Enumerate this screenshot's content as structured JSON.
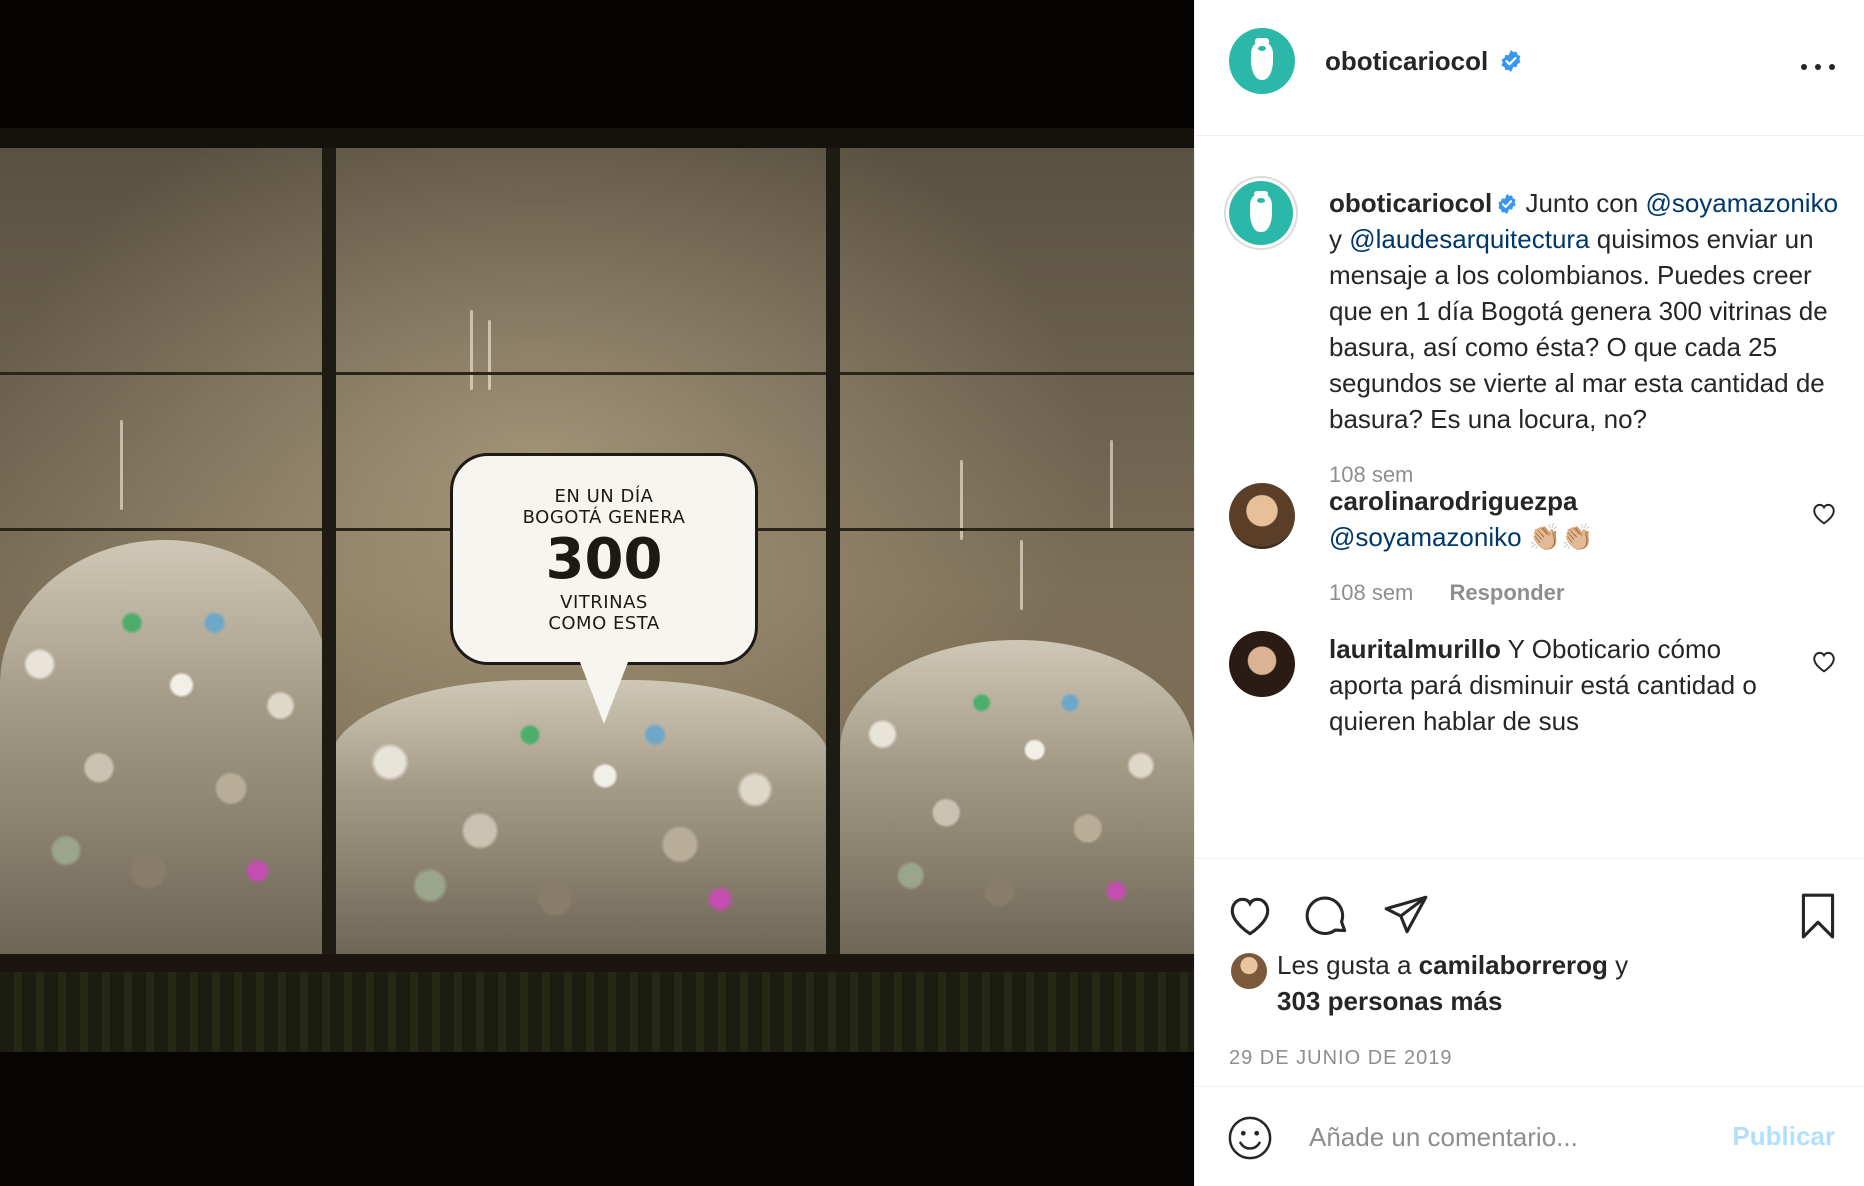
{
  "photo": {
    "bubble_line1": "EN UN DÍA",
    "bubble_line2": "BOGOTÁ GENERA",
    "bubble_number": "300",
    "bubble_line3": "VITRINAS",
    "bubble_line4": "COMO ESTA"
  },
  "header": {
    "username": "oboticariocol",
    "verified_icon": "verified-badge-icon",
    "more_icon": "more-options-icon"
  },
  "caption": {
    "username": "oboticariocol",
    "text_before": " Junto con ",
    "mention1": "@soyamazoniko",
    "text_mid": " y ",
    "mention2": "@laudesarquitectura",
    "text_after": " quisimos enviar un mensaje a los colombianos. Puedes creer que en 1 día Bogotá genera 300 vitrinas de basura, así como ésta? O que cada 25 segundos se vierte al mar esta cantidad de basura? Es una locura, no?",
    "time": "108 sem"
  },
  "comments": [
    {
      "username": "carolinarodriguezpa",
      "mention": "@soyamazoniko",
      "text": " 👏🏼👏🏼",
      "time": "108 sem",
      "reply_label": "Responder"
    },
    {
      "username": "lauritalmurillo",
      "text": " Y Oboticario cómo aporta pará disminuir está cantidad o quieren hablar de sus"
    }
  ],
  "likes": {
    "prefix": "Les gusta a ",
    "user": "camilaborrerog",
    "suffix": " y",
    "others": "303 personas más"
  },
  "date": "29 DE JUNIO DE 2019",
  "add_comment": {
    "placeholder": "Añade un comentario...",
    "publish_label": "Publicar"
  },
  "colors": {
    "brand_teal": "#2bb8a8",
    "verified_blue": "#3897f0",
    "mention_blue": "#00376b",
    "publish_disabled": "#b2dffc",
    "muted_text": "#8e8e8e"
  }
}
